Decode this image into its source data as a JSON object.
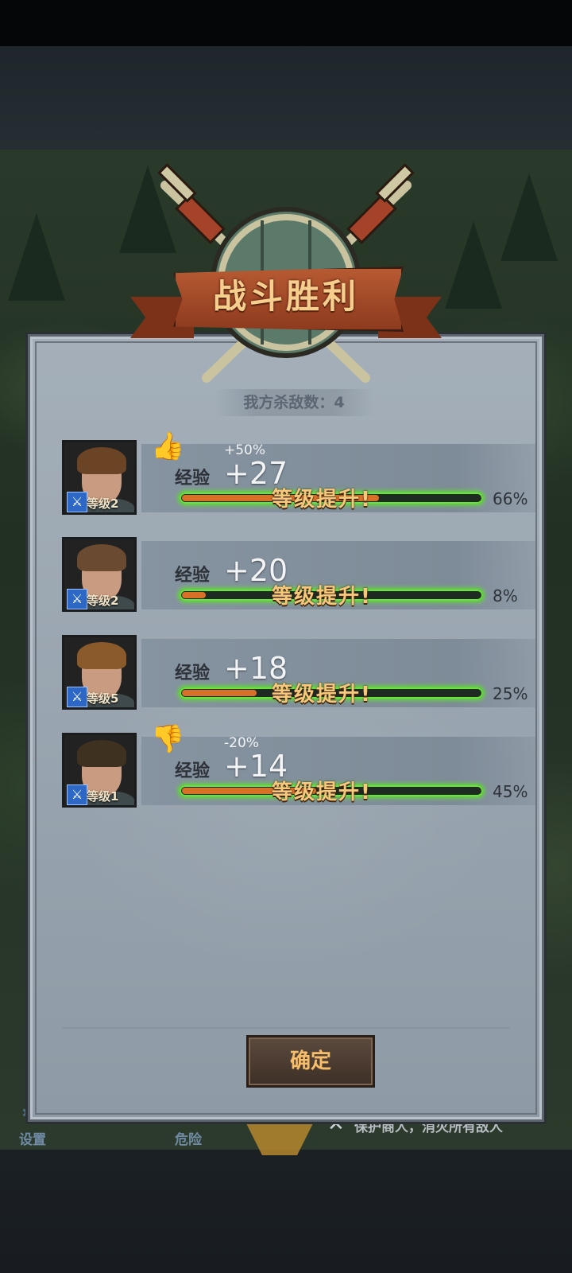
{
  "hud": {
    "settings_label": "设置",
    "danger_label": "危险",
    "mission_text": "保护商人，消灭所有敌人"
  },
  "result": {
    "title": "战斗胜利",
    "kills_text": "我方杀敌数：4",
    "confirm_label": "确定"
  },
  "colors": {
    "exp_bar_glow": "#5de030",
    "exp_bar_fill": "#d8702a",
    "level_up_text": "#f6c87c",
    "banner": "#b75a33"
  },
  "heroes": [
    {
      "level": "等级2",
      "exp_label": "经验",
      "exp_gain": "+27",
      "bonus": "+50%",
      "bonus_icon": "thumbs-up-icon",
      "level_up": "等级提升!",
      "progress_text": "66%",
      "progress": 0.66,
      "portrait": "brown-long-hair-man"
    },
    {
      "level": "等级2",
      "exp_label": "经验",
      "exp_gain": "+20",
      "bonus": "",
      "bonus_icon": "",
      "level_up": "等级提升!",
      "progress_text": "8%",
      "progress": 0.08,
      "portrait": "brown-short-hair-man"
    },
    {
      "level": "等级5",
      "exp_label": "经验",
      "exp_gain": "+18",
      "bonus": "",
      "bonus_icon": "",
      "level_up": "等级提升!",
      "progress_text": "25%",
      "progress": 0.25,
      "portrait": "ginger-hair-man"
    },
    {
      "level": "等级1",
      "exp_label": "经验",
      "exp_gain": "+14",
      "bonus": "-20%",
      "bonus_icon": "thumbs-down-icon",
      "level_up": "等级提升!",
      "progress_text": "45%",
      "progress": 0.45,
      "portrait": "dark-hair-man"
    }
  ]
}
